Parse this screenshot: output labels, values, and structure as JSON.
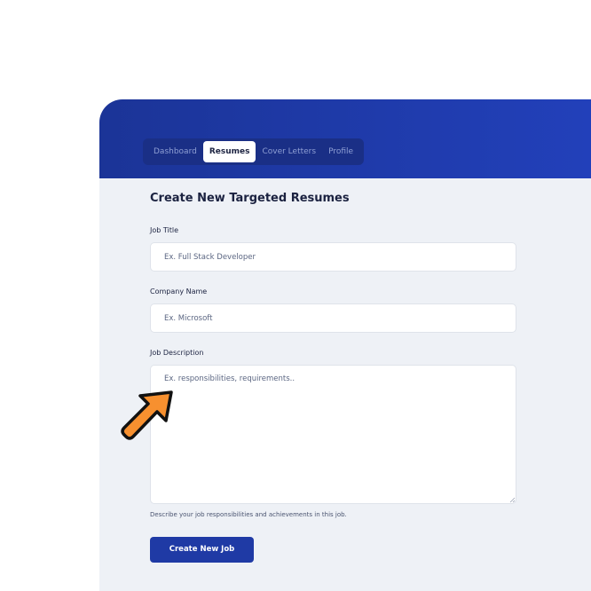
{
  "nav": {
    "tabs": [
      {
        "label": "Dashboard",
        "active": false
      },
      {
        "label": "Resumes",
        "active": true
      },
      {
        "label": "Cover Letters",
        "active": false
      },
      {
        "label": "Profile",
        "active": false
      }
    ]
  },
  "form": {
    "title": "Create New Targeted Resumes",
    "job_title": {
      "label": "Job Title",
      "placeholder": "Ex. Full Stack Developer",
      "value": ""
    },
    "company_name": {
      "label": "Company Name",
      "placeholder": "Ex. Microsoft",
      "value": ""
    },
    "job_description": {
      "label": "Job Description",
      "placeholder": "Ex. responsibilities, requirements..",
      "value": "",
      "helper": "Describe your job responsibilities and achievements in this job."
    },
    "submit_label": "Create New Job"
  },
  "colors": {
    "header": "#1f3aa8",
    "tabs_bg": "#1a2f86",
    "page_bg": "#eef1f6",
    "button": "#1f3aa5",
    "pointer": "#f7902f"
  },
  "icons": {
    "pointer": "cursor-arrow-icon"
  }
}
